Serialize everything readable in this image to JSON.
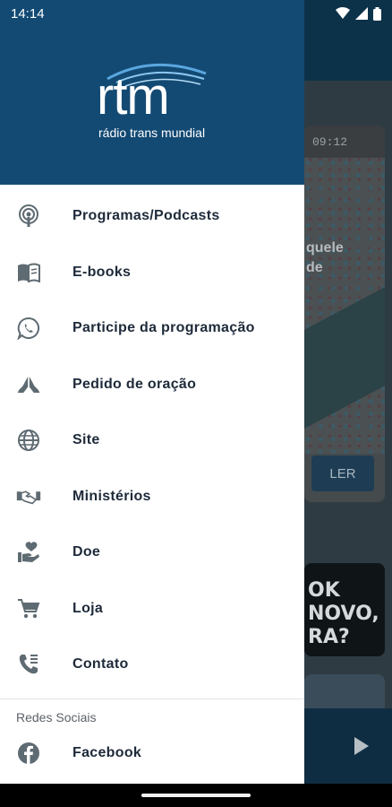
{
  "status_bar": {
    "time": "14:14"
  },
  "background": {
    "card_time": "09:12",
    "card_text_line1": "quele",
    "card_text_line2": "de",
    "read_button": "LER",
    "promo_line1": "OK",
    "promo_line2": "NOVO,",
    "promo_line3": "RA?"
  },
  "brand": {
    "logo_text": "rtm",
    "logo_subtitle": "rádio trans mundial"
  },
  "menu": [
    {
      "label": "Programas/Podcasts",
      "icon": "podcast-icon"
    },
    {
      "label": "E-books",
      "icon": "book-icon"
    },
    {
      "label": "Participe da programação",
      "icon": "whatsapp-icon"
    },
    {
      "label": "Pedido de oração",
      "icon": "praying-hands-icon"
    },
    {
      "label": "Site",
      "icon": "globe-icon"
    },
    {
      "label": "Ministérios",
      "icon": "handshake-icon"
    },
    {
      "label": "Doe",
      "icon": "donate-heart-icon"
    },
    {
      "label": "Loja",
      "icon": "cart-icon"
    },
    {
      "label": "Contato",
      "icon": "phone-icon"
    }
  ],
  "social": {
    "section_title": "Redes Sociais",
    "items": [
      {
        "label": "Facebook",
        "icon": "facebook-icon"
      }
    ]
  },
  "colors": {
    "header": "#134a73",
    "text": "#1e2a3a",
    "icon": "#5f6b72"
  }
}
